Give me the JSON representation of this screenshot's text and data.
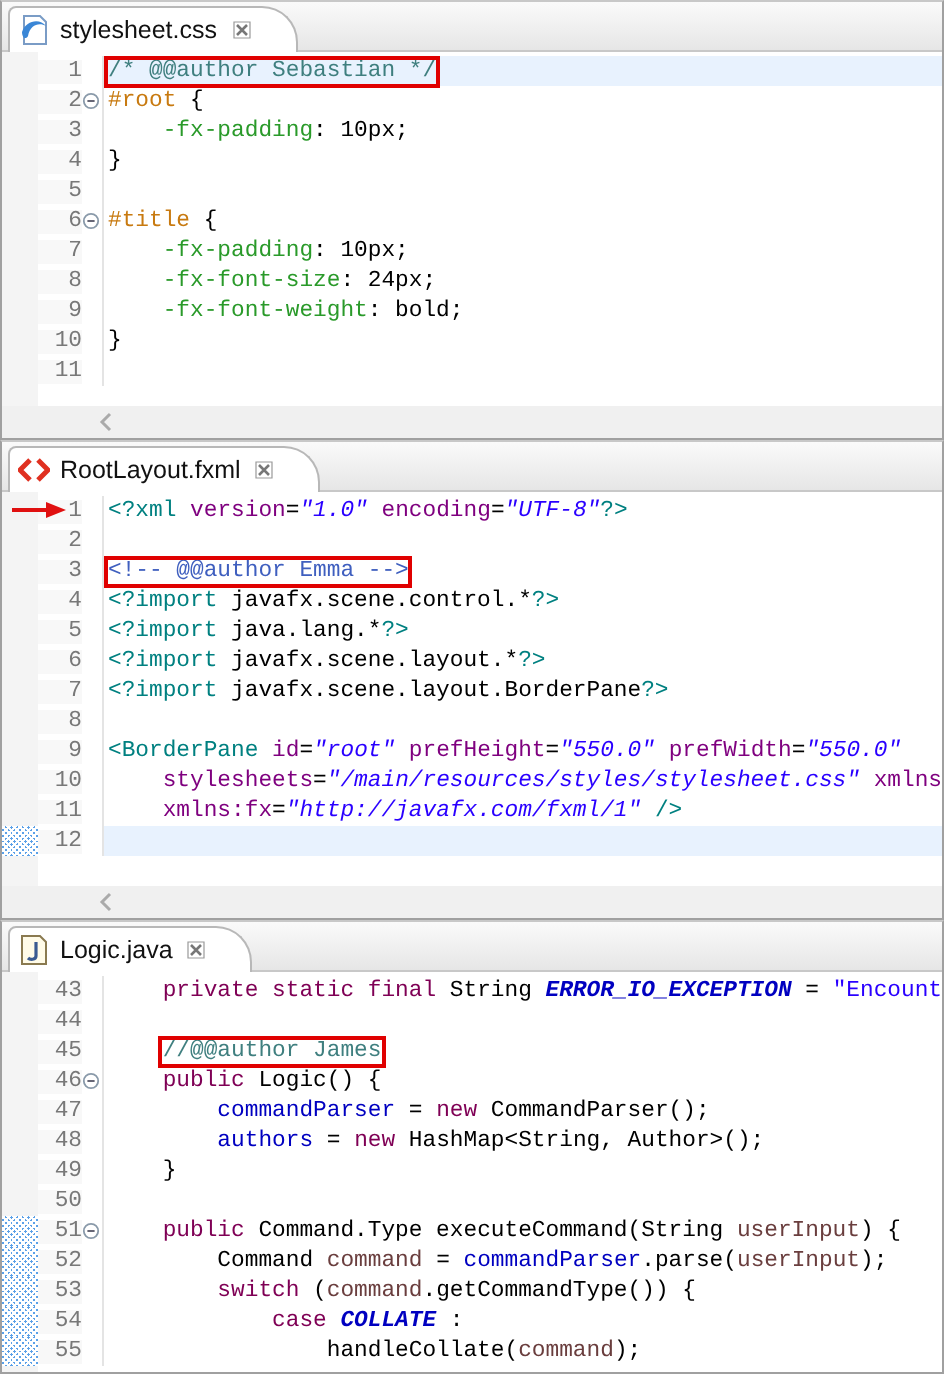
{
  "editors": [
    {
      "tab": {
        "title": "stylesheet.css"
      },
      "scrollbar": true,
      "lines": [
        {
          "number": "1",
          "current": true,
          "tokens": [
            {
              "text": "/* @@author Sebastian */",
              "kind": "comment",
              "boxed": true
            }
          ]
        },
        {
          "number": "2",
          "fold": true,
          "tokens": [
            {
              "text": "#root",
              "kind": "selector"
            },
            {
              "text": " {",
              "kind": "plain"
            }
          ]
        },
        {
          "number": "3",
          "tokens": [
            {
              "text": "    -fx-padding",
              "kind": "property"
            },
            {
              "text": ": 10px;",
              "kind": "plain"
            }
          ]
        },
        {
          "number": "4",
          "tokens": [
            {
              "text": "}",
              "kind": "plain"
            }
          ]
        },
        {
          "number": "5"
        },
        {
          "number": "6",
          "fold": true,
          "tokens": [
            {
              "text": "#title",
              "kind": "selector"
            },
            {
              "text": " {",
              "kind": "plain"
            }
          ]
        },
        {
          "number": "7",
          "tokens": [
            {
              "text": "    -fx-padding",
              "kind": "property"
            },
            {
              "text": ": 10px;",
              "kind": "plain"
            }
          ]
        },
        {
          "number": "8",
          "tokens": [
            {
              "text": "    -fx-font-size",
              "kind": "property"
            },
            {
              "text": ": 24px;",
              "kind": "plain"
            }
          ]
        },
        {
          "number": "9",
          "tokens": [
            {
              "text": "    -fx-font-weight",
              "kind": "property"
            },
            {
              "text": ": bold;",
              "kind": "plain"
            }
          ]
        },
        {
          "number": "10",
          "tokens": [
            {
              "text": "}",
              "kind": "plain"
            }
          ]
        },
        {
          "number": "11"
        }
      ]
    },
    {
      "tab": {
        "title": "RootLayout.fxml"
      },
      "scrollbar": true,
      "lines": [
        {
          "number": "1",
          "arrow": true,
          "tokens": [
            {
              "text": "<?xml",
              "kind": "pi"
            },
            {
              "text": " version",
              "kind": "attr"
            },
            {
              "text": "=",
              "kind": "plain"
            },
            {
              "text": "\"1.0\"",
              "kind": "string"
            },
            {
              "text": " encoding",
              "kind": "attr"
            },
            {
              "text": "=",
              "kind": "plain"
            },
            {
              "text": "\"UTF-8\"",
              "kind": "string"
            },
            {
              "text": "?>",
              "kind": "pi"
            }
          ]
        },
        {
          "number": "2"
        },
        {
          "number": "3",
          "tokens": [
            {
              "text": "<!-- @@author Emma -->",
              "kind": "doc",
              "boxed": true
            }
          ]
        },
        {
          "number": "4",
          "tokens": [
            {
              "text": "<?import",
              "kind": "pi"
            },
            {
              "text": " javafx.scene.control.*",
              "kind": "plain"
            },
            {
              "text": "?>",
              "kind": "pi"
            }
          ]
        },
        {
          "number": "5",
          "tokens": [
            {
              "text": "<?import",
              "kind": "pi"
            },
            {
              "text": " java.lang.*",
              "kind": "plain"
            },
            {
              "text": "?>",
              "kind": "pi"
            }
          ]
        },
        {
          "number": "6",
          "tokens": [
            {
              "text": "<?import",
              "kind": "pi"
            },
            {
              "text": " javafx.scene.layout.*",
              "kind": "plain"
            },
            {
              "text": "?>",
              "kind": "pi"
            }
          ]
        },
        {
          "number": "7",
          "tokens": [
            {
              "text": "<?import",
              "kind": "pi"
            },
            {
              "text": " javafx.scene.layout.BorderPane",
              "kind": "plain"
            },
            {
              "text": "?>",
              "kind": "pi"
            }
          ]
        },
        {
          "number": "8"
        },
        {
          "number": "9",
          "tokens": [
            {
              "text": "<BorderPane",
              "kind": "pi"
            },
            {
              "text": " id",
              "kind": "attr"
            },
            {
              "text": "=",
              "kind": "plain"
            },
            {
              "text": "\"root\"",
              "kind": "string"
            },
            {
              "text": " prefHeight",
              "kind": "attr"
            },
            {
              "text": "=",
              "kind": "plain"
            },
            {
              "text": "\"550.0\"",
              "kind": "string"
            },
            {
              "text": " prefWidth",
              "kind": "attr"
            },
            {
              "text": "=",
              "kind": "plain"
            },
            {
              "text": "\"550.0\"",
              "kind": "string"
            }
          ]
        },
        {
          "number": "10",
          "tokens": [
            {
              "text": "    stylesheets",
              "kind": "attr"
            },
            {
              "text": "=",
              "kind": "plain"
            },
            {
              "text": "\"/main/resources/styles/stylesheet.css\"",
              "kind": "string"
            },
            {
              "text": " xmlns",
              "kind": "attr"
            }
          ]
        },
        {
          "number": "11",
          "tokens": [
            {
              "text": "    xmlns:fx",
              "kind": "attr"
            },
            {
              "text": "=",
              "kind": "plain"
            },
            {
              "text": "\"http://javafx.com/fxml/1\"",
              "kind": "string"
            },
            {
              "text": " />",
              "kind": "pi"
            }
          ]
        },
        {
          "number": "12",
          "current": true,
          "changed": true
        }
      ]
    },
    {
      "tab": {
        "title": "Logic.java"
      },
      "lines": [
        {
          "number": "43",
          "tokens": [
            {
              "text": "    private static final",
              "kind": "keyword"
            },
            {
              "text": " String ",
              "kind": "plain"
            },
            {
              "text": "ERROR_IO_EXCEPTION",
              "kind": "constant"
            },
            {
              "text": " = ",
              "kind": "plain"
            },
            {
              "text": "\"Encount",
              "kind": "jstring"
            }
          ]
        },
        {
          "number": "44"
        },
        {
          "number": "45",
          "tokens": [
            {
              "text": "    //@@author James",
              "kind": "comment",
              "boxed": true
            }
          ]
        },
        {
          "number": "46",
          "fold": true,
          "tokens": [
            {
              "text": "    public",
              "kind": "keyword"
            },
            {
              "text": " Logic() {",
              "kind": "plain"
            }
          ]
        },
        {
          "number": "47",
          "tokens": [
            {
              "text": "        commandParser",
              "kind": "field"
            },
            {
              "text": " = ",
              "kind": "plain"
            },
            {
              "text": "new",
              "kind": "keyword"
            },
            {
              "text": " CommandParser();",
              "kind": "plain"
            }
          ]
        },
        {
          "number": "48",
          "tokens": [
            {
              "text": "        authors",
              "kind": "field"
            },
            {
              "text": " = ",
              "kind": "plain"
            },
            {
              "text": "new",
              "kind": "keyword"
            },
            {
              "text": " HashMap<String, Author>();",
              "kind": "plain"
            }
          ]
        },
        {
          "number": "49",
          "tokens": [
            {
              "text": "    }",
              "kind": "plain"
            }
          ]
        },
        {
          "number": "50"
        },
        {
          "number": "51",
          "fold": true,
          "changed": true,
          "tokens": [
            {
              "text": "    public",
              "kind": "keyword"
            },
            {
              "text": " Command.Type executeCommand(String ",
              "kind": "plain"
            },
            {
              "text": "userInput",
              "kind": "local"
            },
            {
              "text": ") {",
              "kind": "plain"
            }
          ]
        },
        {
          "number": "52",
          "changed": true,
          "tokens": [
            {
              "text": "        Command ",
              "kind": "plain"
            },
            {
              "text": "command",
              "kind": "local"
            },
            {
              "text": " = ",
              "kind": "plain"
            },
            {
              "text": "commandParser",
              "kind": "field"
            },
            {
              "text": ".parse(",
              "kind": "plain"
            },
            {
              "text": "userInput",
              "kind": "local"
            },
            {
              "text": ");",
              "kind": "plain"
            }
          ]
        },
        {
          "number": "53",
          "changed": true,
          "tokens": [
            {
              "text": "        switch",
              "kind": "keyword"
            },
            {
              "text": " (",
              "kind": "plain"
            },
            {
              "text": "command",
              "kind": "local"
            },
            {
              "text": ".getCommandType()) {",
              "kind": "plain"
            }
          ]
        },
        {
          "number": "54",
          "changed": true,
          "tokens": [
            {
              "text": "            case",
              "kind": "keyword"
            },
            {
              "text": " COLLATE",
              "kind": "constant"
            },
            {
              "text": " :",
              "kind": "plain"
            }
          ]
        },
        {
          "number": "55",
          "changed": true,
          "tokens": [
            {
              "text": "                handleCollate(",
              "kind": "plain"
            },
            {
              "text": "command",
              "kind": "local"
            },
            {
              "text": ");",
              "kind": "plain"
            }
          ]
        }
      ]
    }
  ]
}
